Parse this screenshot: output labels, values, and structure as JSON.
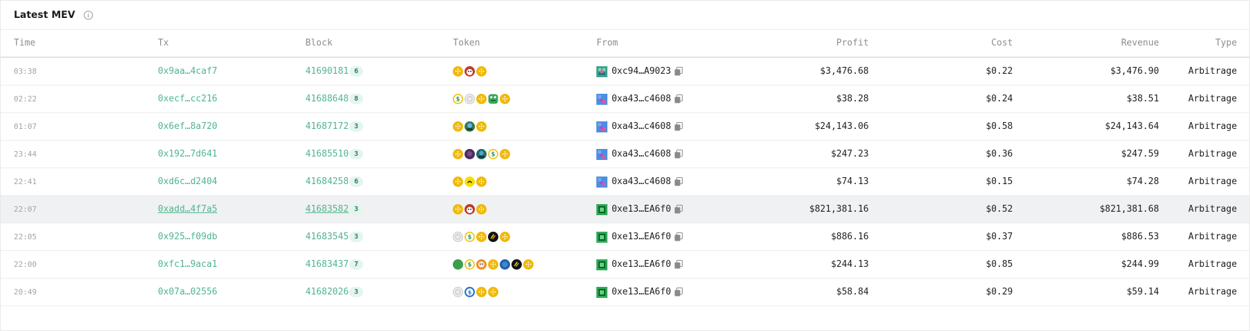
{
  "header": {
    "title": "Latest MEV"
  },
  "columns": {
    "time": "Time",
    "tx": "Tx",
    "block": "Block",
    "token": "Token",
    "from": "From",
    "profit": "Profit",
    "cost": "Cost",
    "revenue": "Revenue",
    "type": "Type"
  },
  "rows": [
    {
      "time": "03:38",
      "tx": "0x9aa…4caf7",
      "block": "41690181",
      "badge": "6",
      "tokens": [
        "bnb-icon",
        "red-frog-icon",
        "bnb-icon"
      ],
      "avatar": "avatar-green-teal",
      "from": "0xc94…A9023",
      "profit": "$3,476.68",
      "cost": "$0.22",
      "revenue": "$3,476.90",
      "type": "Arbitrage"
    },
    {
      "time": "02:22",
      "tx": "0xecf…cc216",
      "block": "41688648",
      "badge": "8",
      "tokens": [
        "usd-green-icon",
        "grey-coin-icon",
        "bnb-icon",
        "green-frog-icon",
        "bnb-icon"
      ],
      "avatar": "avatar-blue-pink",
      "from": "0xa43…c4608",
      "profit": "$38.28",
      "cost": "$0.24",
      "revenue": "$38.51",
      "type": "Arbitrage"
    },
    {
      "time": "01:07",
      "tx": "0x6ef…8a720",
      "block": "41687172",
      "badge": "3",
      "tokens": [
        "bnb-icon",
        "green-face-icon",
        "bnb-icon"
      ],
      "avatar": "avatar-blue-pink",
      "from": "0xa43…c4608",
      "profit": "$24,143.06",
      "cost": "$0.58",
      "revenue": "$24,143.64",
      "type": "Arbitrage"
    },
    {
      "time": "23:44",
      "tx": "0x192…7d641",
      "block": "41685510",
      "badge": "3",
      "tokens": [
        "bnb-icon",
        "purple-face-icon",
        "teal-face-icon",
        "usd-green-icon",
        "bnb-icon"
      ],
      "avatar": "avatar-blue-pink",
      "from": "0xa43…c4608",
      "profit": "$247.23",
      "cost": "$0.36",
      "revenue": "$247.59",
      "type": "Arbitrage"
    },
    {
      "time": "22:41",
      "tx": "0xd6c…d2404",
      "block": "41684258",
      "badge": "6",
      "tokens": [
        "bnb-icon",
        "yellow-face-icon",
        "bnb-icon"
      ],
      "avatar": "avatar-blue-pink",
      "from": "0xa43…c4608",
      "profit": "$74.13",
      "cost": "$0.15",
      "revenue": "$74.28",
      "type": "Arbitrage"
    },
    {
      "time": "22:07",
      "tx": "0xadd…4f7a5",
      "block": "41683582",
      "badge": "3",
      "tokens": [
        "bnb-icon",
        "red-frog-icon",
        "bnb-icon"
      ],
      "avatar": "avatar-green-box",
      "from": "0xe13…EA6f0",
      "profit": "$821,381.16",
      "cost": "$0.52",
      "revenue": "$821,381.68",
      "type": "Arbitrage",
      "hover": true
    },
    {
      "time": "22:05",
      "tx": "0x925…f09db",
      "block": "41683545",
      "badge": "3",
      "tokens": [
        "grey-coin-icon",
        "usd-green-icon",
        "bnb-icon",
        "black-stripe-icon",
        "bnb-icon"
      ],
      "avatar": "avatar-green-box",
      "from": "0xe13…EA6f0",
      "profit": "$886.16",
      "cost": "$0.37",
      "revenue": "$886.53",
      "type": "Arbitrage"
    },
    {
      "time": "22:00",
      "tx": "0xfc1…9aca1",
      "block": "41683437",
      "badge": "7",
      "tokens": [
        "green-dot-icon",
        "usd-green-icon",
        "orange-face-icon",
        "bnb-icon",
        "blue-dot-icon",
        "black-stripe-icon",
        "bnb-icon"
      ],
      "avatar": "avatar-green-box",
      "from": "0xe13…EA6f0",
      "profit": "$244.13",
      "cost": "$0.85",
      "revenue": "$244.99",
      "type": "Arbitrage"
    },
    {
      "time": "20:49",
      "tx": "0x07a…02556",
      "block": "41682026",
      "badge": "3",
      "tokens": [
        "grey-coin-icon",
        "usdc-blue-icon",
        "bnb-icon",
        "bnb-icon"
      ],
      "avatar": "avatar-green-box",
      "from": "0xe13…EA6f0",
      "profit": "$58.84",
      "cost": "$0.29",
      "revenue": "$59.14",
      "type": "Arbitrage"
    }
  ]
}
